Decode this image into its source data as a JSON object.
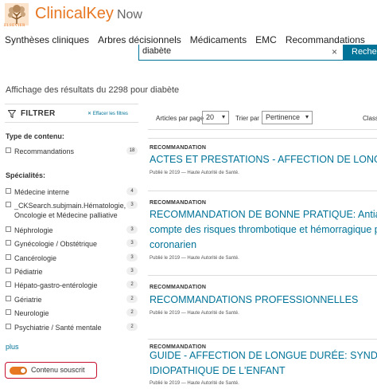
{
  "header": {
    "brand": "ClinicalKey",
    "brand_suffix": "Now",
    "publisher": "ELSEVIER"
  },
  "nav": {
    "items": [
      "Synthèses cliniques",
      "Arbres décisionnels",
      "Médicaments",
      "EMC",
      "Recommandations"
    ]
  },
  "search": {
    "value": "diabète",
    "clear_symbol": "×",
    "button_label": "Recher"
  },
  "results_summary": "Affichage des résultats du 2298 pour diabète",
  "filters": {
    "title": "FILTRER",
    "clear_label": "✕ Effacer les filtres",
    "content_type_label": "Type de contenu:",
    "content_types": [
      {
        "label": "Recommandations",
        "count": "18"
      }
    ],
    "specialties_label": "Spécialités:",
    "specialties": [
      {
        "label": "Médecine interne",
        "count": "4"
      },
      {
        "label": "_CKSearch.subjmain.Hématologie, Oncologie et Médecine palliative",
        "count": "3"
      },
      {
        "label": "Néphrologie",
        "count": "3"
      },
      {
        "label": "Gynécologie / Obstétrique",
        "count": "3"
      },
      {
        "label": "Cancérologie",
        "count": "3"
      },
      {
        "label": "Pédiatrie",
        "count": "3"
      },
      {
        "label": "Hépato-gastro-entérologie",
        "count": "2"
      },
      {
        "label": "Gériatrie",
        "count": "2"
      },
      {
        "label": "Neurologie",
        "count": "2"
      },
      {
        "label": "Psychiatrie / Santé mentale",
        "count": "2"
      }
    ],
    "more_label": "plus",
    "subscribed_toggle_label": "Contenu souscrit",
    "subscribed_toggle_on": true
  },
  "toolbar": {
    "per_page_label": "Articles par page",
    "per_page_value": "20",
    "sort_label": "Trier par",
    "sort_value": "Pertinence",
    "class_label": "Class"
  },
  "results": [
    {
      "type": "RECOMMANDATION",
      "title_lines": [
        "ACTES ET PRESTATIONS - AFFECTION DE LONGUE"
      ],
      "meta": "Publié le 2019 — Haute Autorité de Santé."
    },
    {
      "type": "RECOMMANDATION",
      "title_lines": [
        "RECOMMANDATION DE BONNE PRATIQUE: Antiag",
        "compte des risques thrombotique et hémorragique p",
        "coronarien"
      ],
      "meta": "Publié le 2019 — Haute Autorité de Santé."
    },
    {
      "type": "RECOMMANDATION",
      "title_lines": [
        "RECOMMANDATIONS PROFESSIONNELLES"
      ],
      "meta": "Publié le 2019 — Haute Autorité de Santé."
    },
    {
      "type": "RECOMMANDATION",
      "title_lines": [
        "GUIDE - AFFECTION DE LONGUE DURÉE: SYNDRO",
        "IDIOPATHIQUE DE L'ENFANT"
      ],
      "meta": "Publié le 2019 — Haute Autorité de Santé."
    }
  ],
  "colors": {
    "brand_orange": "#e87722",
    "link_teal": "#007398",
    "highlight_red": "#c8102e"
  }
}
